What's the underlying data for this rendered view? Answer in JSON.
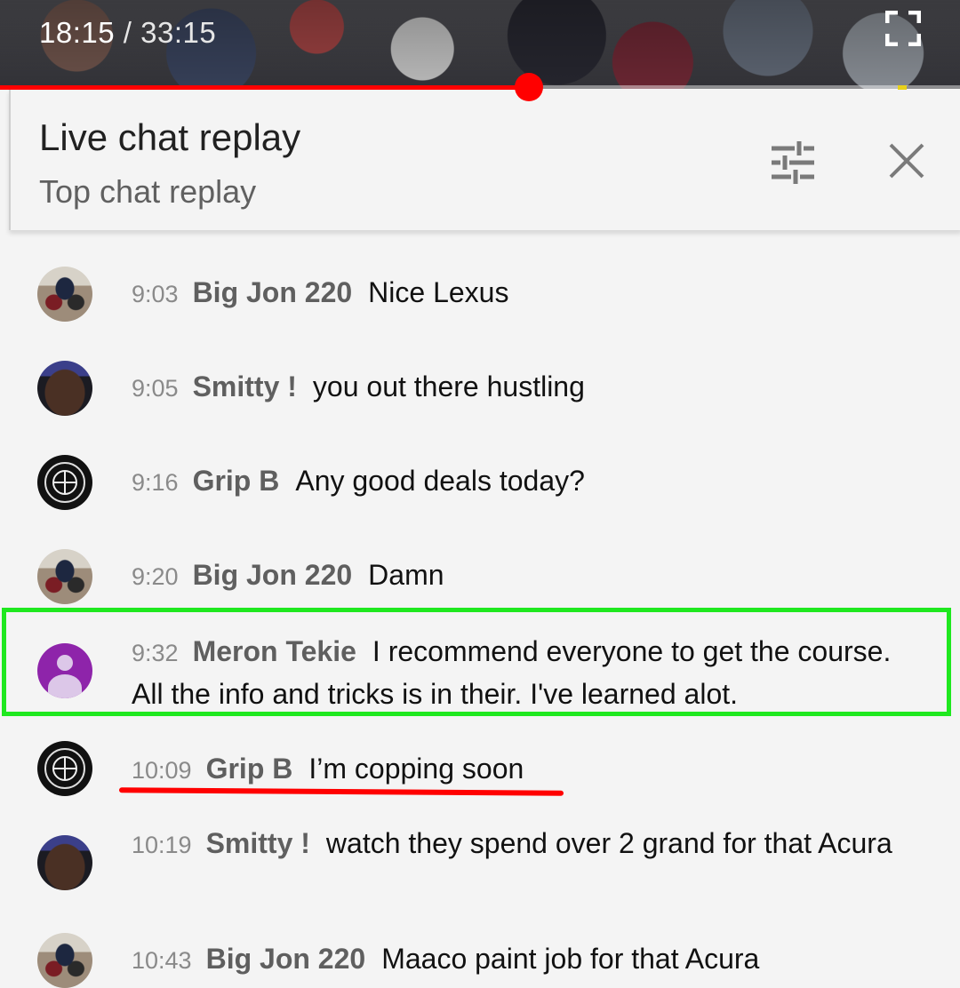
{
  "player": {
    "current_time": "18:15",
    "separator": " / ",
    "duration": "33:15",
    "progress_fraction": 0.5505,
    "fullscreen_icon": "fullscreen-icon"
  },
  "header": {
    "title": "Live chat replay",
    "subtitle": "Top chat replay",
    "filter_icon": "tune-sliders-icon",
    "close_icon": "close-icon"
  },
  "messages": [
    {
      "time": "9:03",
      "author": "Big Jon 220",
      "text": "Nice Lexus",
      "avatar": "big-jon-avatar"
    },
    {
      "time": "9:05",
      "author": "Smitty !",
      "text": "you out there hustling",
      "avatar": "smitty-avatar"
    },
    {
      "time": "9:16",
      "author": "Grip B",
      "text": "Any good deals today?",
      "avatar": "grip-b-avatar"
    },
    {
      "time": "9:20",
      "author": "Big Jon 220",
      "text": "Damn",
      "avatar": "big-jon-avatar"
    },
    {
      "time": "9:32",
      "author": "Meron Tekie",
      "text": "I recommend everyone to get the course. All the info and tricks is in their. I've learned alot.",
      "avatar": "default-profile-avatar"
    },
    {
      "time": "10:09",
      "author": "Grip B",
      "text": "I’m copping soon",
      "avatar": "grip-b-avatar"
    },
    {
      "time": "10:19",
      "author": "Smitty !",
      "text": "watch they spend over 2 grand for that Acura",
      "avatar": "smitty-avatar"
    },
    {
      "time": "10:43",
      "author": "Big Jon 220",
      "text": "Maaco paint job for that Acura",
      "avatar": "big-jon-avatar"
    }
  ],
  "annotations": {
    "highlight_color": "#1fe81f",
    "underline_color": "#ff0000"
  }
}
